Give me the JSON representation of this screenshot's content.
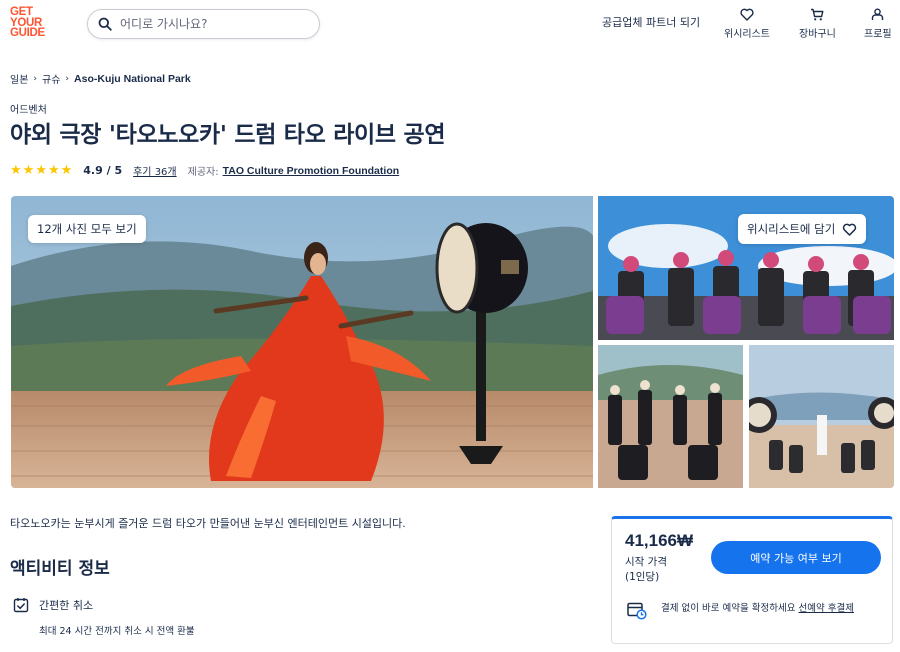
{
  "header": {
    "logo_lines": [
      "GET",
      "YOUR",
      "GUIDE"
    ],
    "search_placeholder": "어디로 가시나요?",
    "supplier_link": "공급업체 파트너 되기",
    "nav": {
      "wishlist": "위시리스트",
      "cart": "장바구니",
      "profile": "프로필"
    }
  },
  "breadcrumb": [
    "일본",
    "규슈",
    "Aso-Kuju National Park"
  ],
  "activity": {
    "category": "어드벤처",
    "title": "야외 극장 '타오노오카' 드럼 타오 라이브 공연",
    "rating": 4.9,
    "rating_text": "4.9 / 5",
    "reviews": "후기 36개",
    "provider_label": "제공자:",
    "provider": "TAO Culture Promotion Foundation",
    "stars": 5
  },
  "gallery": {
    "all_photos": "12개 사진 모두 보기",
    "wishlist_add": "위시리스트에 담기"
  },
  "description": "타오노오카는 눈부시게 즐거운 드럼 타오가 만들어낸 눈부신 엔터테인먼트 시설입니다.",
  "info": {
    "section_title": "액티비티 정보",
    "feature_title": "간편한 취소",
    "feature_sub": "최대 24 시간 전까지 취소 시 전액 환불"
  },
  "booking": {
    "price": "41,166₩",
    "price_note_1": "시작 가격",
    "price_note_2": "(1인당)",
    "button": "예약 가능 여부 보기",
    "reserve_text": "결제 없이 바로 예약을 확정하세요 ",
    "reserve_link": "선예약 후결제"
  },
  "colors": {
    "brand": "#ff5533",
    "primary": "#1673ee",
    "text": "#1a2b49",
    "star": "#fdc500"
  }
}
